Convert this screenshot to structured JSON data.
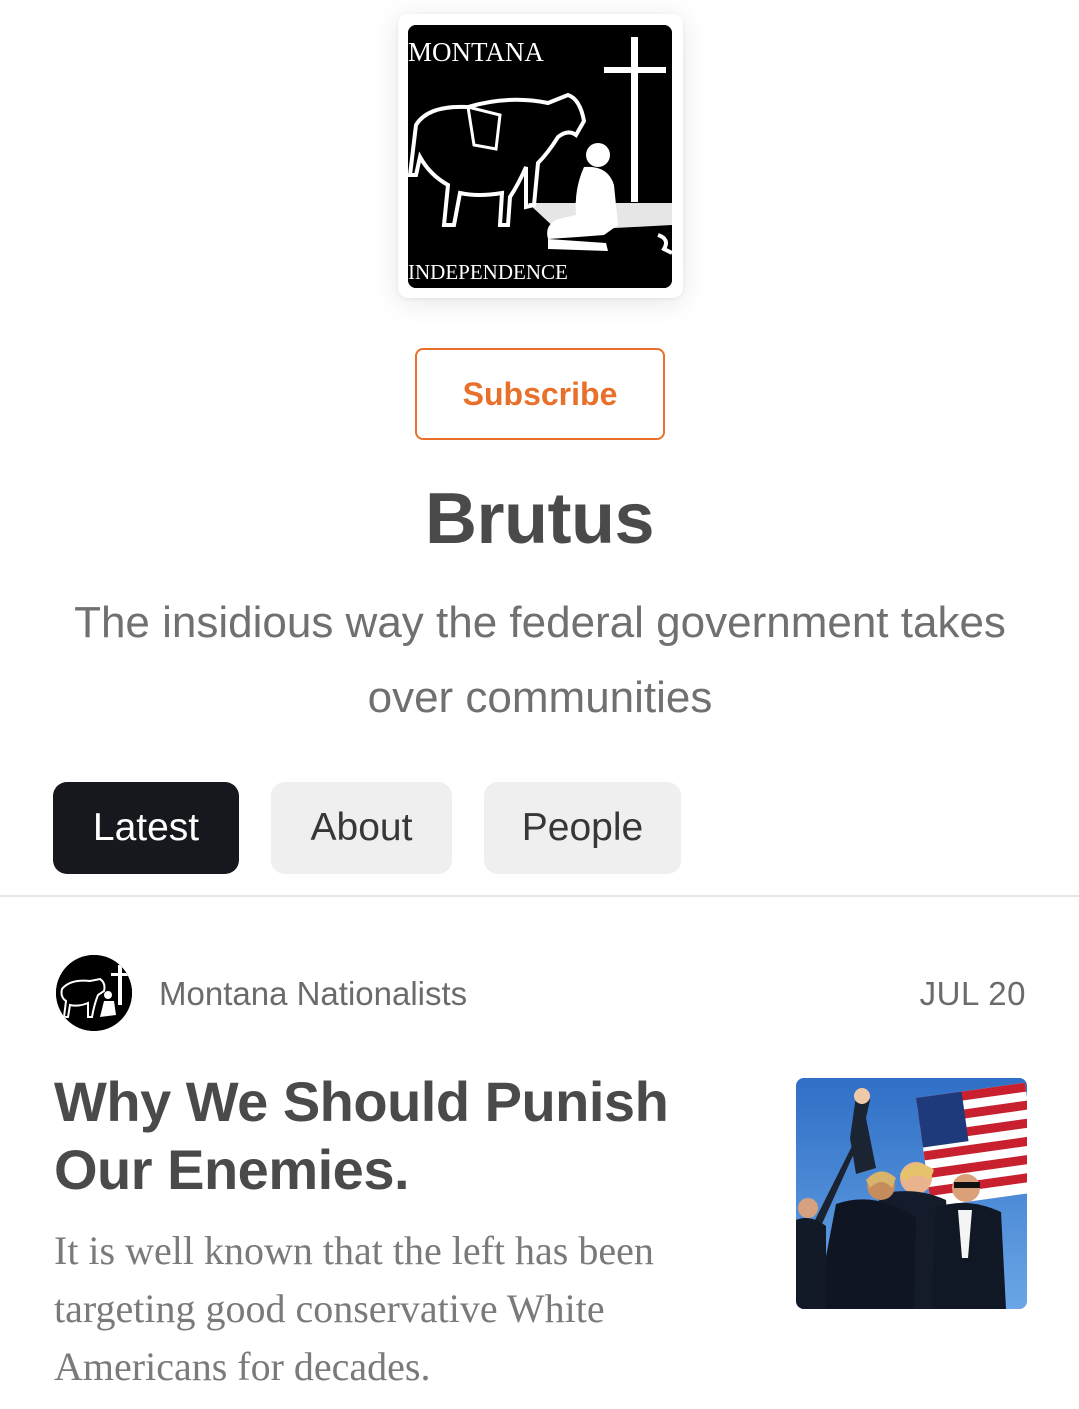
{
  "publication": {
    "logo_text_top": "MONTANA",
    "logo_text_bottom": "INDEPENDENCE",
    "subscribe_label": "Subscribe",
    "title": "Brutus",
    "subtitle": "The insidious way the federal government takes over communities"
  },
  "tabs": [
    {
      "label": "Latest",
      "active": true
    },
    {
      "label": "About",
      "active": false
    },
    {
      "label": "People",
      "active": false
    }
  ],
  "post": {
    "author": "Montana Nationalists",
    "date": "JUL 20",
    "title": "Why We Should Punish Our Enemies.",
    "excerpt": "It is well known that the left has been targeting good conservative White Americans for decades.",
    "thumbnail_icon": "photo-thumbnail"
  },
  "colors": {
    "accent": "#e8702a",
    "active_tab_bg": "#16181d",
    "inactive_tab_bg": "#efefef"
  }
}
